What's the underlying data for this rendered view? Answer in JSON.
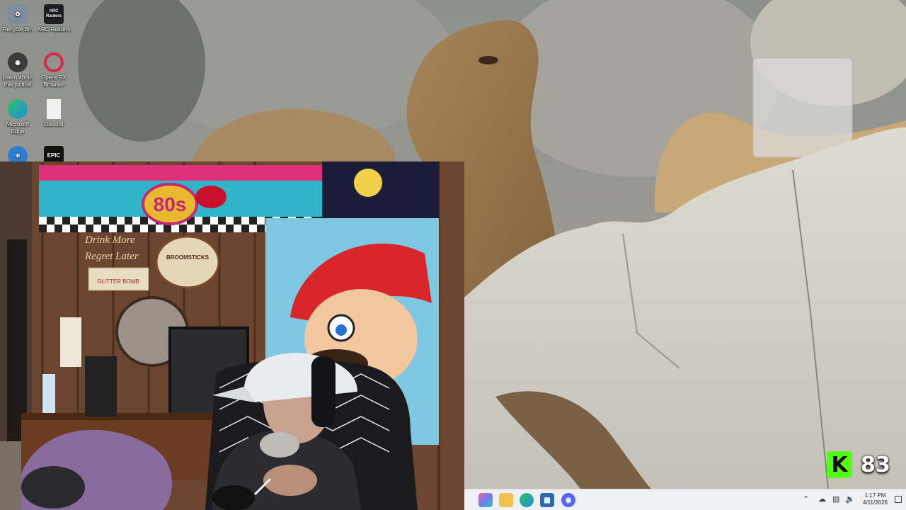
{
  "desktop": {
    "icons": [
      {
        "label": "Recycle Bin",
        "icon": "recycle-bin-icon",
        "color": "#6a7a8c"
      },
      {
        "label": "ARC Raiders",
        "icon": "arc-raiders-icon",
        "color": "#1d1d24",
        "glyph_text": "ARC Raiders"
      },
      {
        "label": "Learn about this picture",
        "icon": "camera-info-icon",
        "color": "#3c3c3c"
      },
      {
        "label": "Opera GX Browser",
        "icon": "opera-gx-icon",
        "color": "#d32a4b"
      },
      {
        "label": "Microsoft Edge",
        "icon": "edge-icon",
        "color": "#1f8fd8"
      },
      {
        "label": "Discord",
        "icon": "file-icon",
        "color": "#f2f2f2"
      },
      {
        "label": "",
        "icon": "atom-app-icon",
        "color": "#2a7fd4"
      },
      {
        "label": "",
        "icon": "epic-games-icon",
        "color": "#111111",
        "glyph_text": "EPIC"
      }
    ]
  },
  "webcam": {
    "sign_80s": "80s",
    "sign_broomsticks": "BROOMSTICKS",
    "sign_glitter": "GLITTER BOMB",
    "sign_drink": "Drink More",
    "sign_regret": "Regret Later"
  },
  "taskbar": {
    "apps": [
      {
        "name": "copilot-icon",
        "color": "#b45ad6"
      },
      {
        "name": "file-explorer-icon",
        "color": "#f2c14e"
      },
      {
        "name": "edge-taskbar-icon",
        "color": "#1f8fd8"
      },
      {
        "name": "store-icon",
        "color": "#2b6cb0"
      },
      {
        "name": "discord-taskbar-icon",
        "color": "#5865f2"
      }
    ],
    "time": "1:17 PM",
    "date": "4/11/2026"
  },
  "kick": {
    "logo": "K",
    "viewer_count": "83",
    "brand_color": "#53fc18"
  }
}
